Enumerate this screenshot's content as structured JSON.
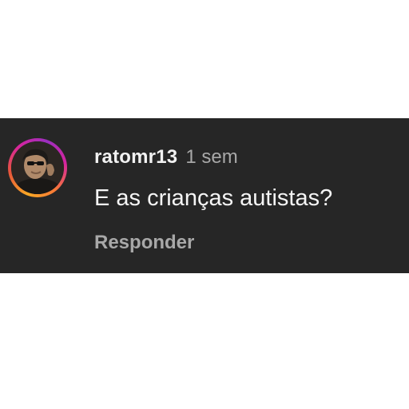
{
  "comment": {
    "username": "ratomr13",
    "timestamp": "1 sem",
    "text": "E as crianças autistas?",
    "reply_label": "Responder"
  },
  "avatar": {
    "icon": "profile-photo",
    "ring_colors": [
      "#f9a825",
      "#e8563a",
      "#d6249f",
      "#9b2fbf"
    ]
  },
  "colors": {
    "card_background": "#262626",
    "primary_text": "#f2f2f2",
    "secondary_text": "#a8a8a8"
  }
}
